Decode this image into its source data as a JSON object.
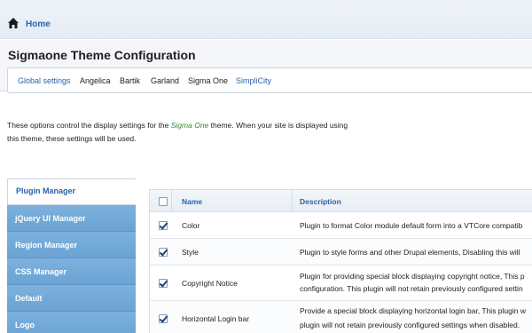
{
  "topbar": {
    "home_label": "Home"
  },
  "page_title": "Sigmaone Theme Configuration",
  "tabs": [
    {
      "label": "Global settings",
      "style": "link"
    },
    {
      "label": "Angelica",
      "style": "plain"
    },
    {
      "label": "Bartik",
      "style": "plain"
    },
    {
      "label": "Garland",
      "style": "plain"
    },
    {
      "label": "Sigma One",
      "style": "plain"
    },
    {
      "label": "SimpliCity",
      "style": "link"
    }
  ],
  "intro": {
    "line1_before": "These options control the display settings for the ",
    "line1_theme": "Sigma One",
    "line1_after": " theme. When your site is displayed using",
    "line2": "this theme, these settings will be used."
  },
  "sidebar": {
    "items": [
      {
        "label": "Plugin Manager",
        "active": true
      },
      {
        "label": "jQuery UI Manager",
        "active": false
      },
      {
        "label": "Region Manager",
        "active": false
      },
      {
        "label": "CSS Manager",
        "active": false
      },
      {
        "label": "Default",
        "active": false
      },
      {
        "label": "Logo",
        "active": false
      }
    ]
  },
  "table": {
    "headers": {
      "name": "Name",
      "description": "Description"
    },
    "rows": [
      {
        "name": "Color",
        "checked": true,
        "desc1": "Plugin to format Color module default form into a VTCore compatib",
        "desc2": ""
      },
      {
        "name": "Style",
        "checked": true,
        "desc1": "Plugin to style forms and other Drupal elements, Disabling this will",
        "desc2": ""
      },
      {
        "name": "Copyright Notice",
        "checked": true,
        "desc1": "Plugin for providing special block displaying copyright notice, This p",
        "desc2": "configuration. This plugin will not retain previously configured settin"
      },
      {
        "name": "Horizontal Login bar",
        "checked": true,
        "desc1": "Provide a special block displaying horizontal login bar, This plugin w",
        "desc2": "plugin will not retain previously configured settings when disabled."
      }
    ]
  },
  "colors": {
    "link": "#2a63a8",
    "accent_green": "#2e8b2e",
    "sidebar_blue": "#7eb1dc"
  }
}
